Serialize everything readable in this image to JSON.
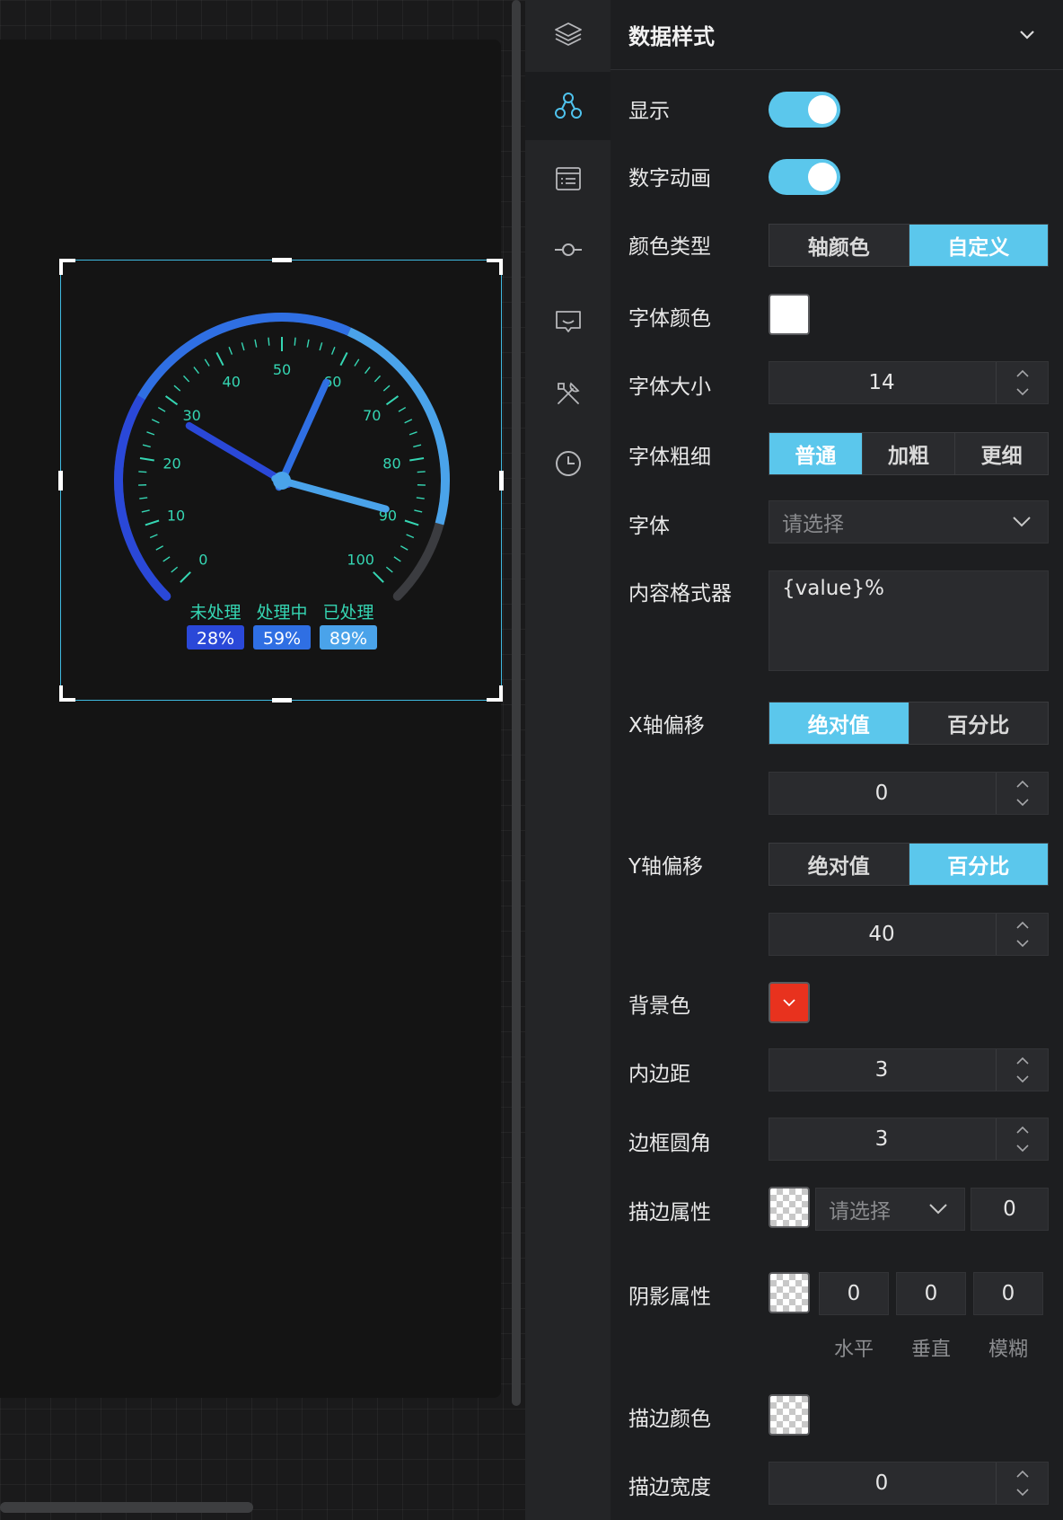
{
  "gauge": {
    "min": 0,
    "max": 100,
    "major_ticks": [
      "0",
      "10",
      "20",
      "30",
      "40",
      "50",
      "60",
      "70",
      "80",
      "90",
      "100"
    ],
    "pointers": [
      {
        "name": "未处理",
        "value": 28,
        "label": "28%",
        "color": "#2a48d8"
      },
      {
        "name": "处理中",
        "value": 59,
        "label": "59%",
        "color": "#2f6fe3"
      },
      {
        "name": "已处理",
        "value": 89,
        "label": "89%",
        "color": "#4aa3ea"
      }
    ],
    "tick_color": "#35d6b3",
    "track_color": "#3b3c40"
  },
  "iconbar": {
    "items": [
      {
        "icon": "layers-icon",
        "active": false
      },
      {
        "icon": "nodes-icon",
        "active": true
      },
      {
        "icon": "list-icon",
        "active": false
      },
      {
        "icon": "connector-icon",
        "active": false
      },
      {
        "icon": "chat-icon",
        "active": false
      },
      {
        "icon": "tools-icon",
        "active": false
      },
      {
        "icon": "clock-icon",
        "active": false
      }
    ]
  },
  "panel": {
    "title": "数据样式",
    "show_label": "显示",
    "anim_label": "数字动画",
    "color_type": {
      "label": "颜色类型",
      "options": [
        "轴颜色",
        "自定义"
      ],
      "selected": 1
    },
    "font_color": {
      "label": "字体颜色",
      "value": "#ffffff"
    },
    "font_size": {
      "label": "字体大小",
      "value": "14"
    },
    "font_weight": {
      "label": "字体粗细",
      "options": [
        "普通",
        "加粗",
        "更细"
      ],
      "selected": 0
    },
    "font_family": {
      "label": "字体",
      "placeholder": "请选择"
    },
    "formatter": {
      "label": "内容格式器",
      "value": "{value}%"
    },
    "x_offset": {
      "label": "X轴偏移",
      "options": [
        "绝对值",
        "百分比"
      ],
      "selected": 0,
      "value": "0"
    },
    "y_offset": {
      "label": "Y轴偏移",
      "options": [
        "绝对值",
        "百分比"
      ],
      "selected": 1,
      "value": "40"
    },
    "bg_color": {
      "label": "背景色",
      "value": "#e8321e"
    },
    "padding": {
      "label": "内边距",
      "value": "3"
    },
    "radius": {
      "label": "边框圆角",
      "value": "3"
    },
    "stroke_attr": {
      "label": "描边属性",
      "placeholder": "请选择",
      "value": "0"
    },
    "shadow_attr": {
      "label": "阴影属性",
      "values": [
        "0",
        "0",
        "0"
      ],
      "sub_labels": [
        "水平",
        "垂直",
        "模糊"
      ]
    },
    "stroke_color": {
      "label": "描边颜色"
    },
    "stroke_width": {
      "label": "描边宽度",
      "value": "0"
    }
  }
}
